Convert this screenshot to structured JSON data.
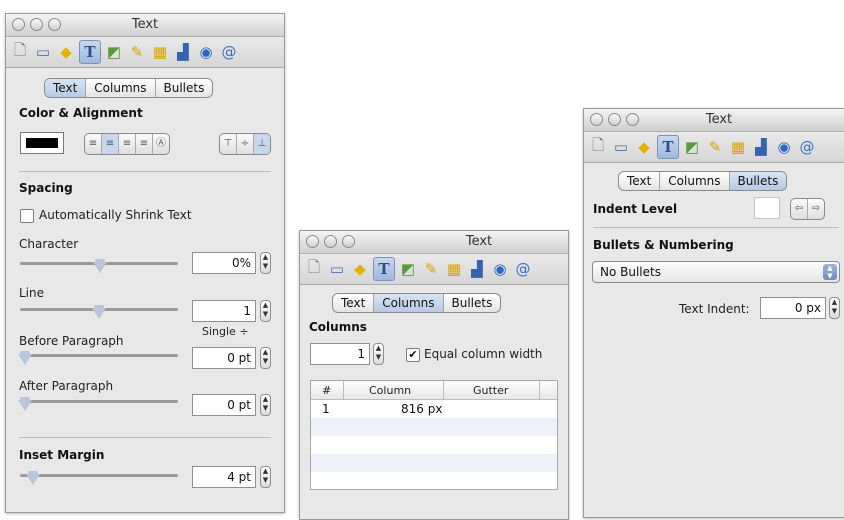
{
  "toolbar_icons": [
    "document-icon",
    "layout-icon",
    "wrap-icon",
    "text-icon",
    "graphic-icon",
    "metrics-icon",
    "table-icon",
    "chart-icon",
    "link-icon",
    "quicktime-icon"
  ],
  "panel1": {
    "title": "Text",
    "tabs": [
      "Text",
      "Columns",
      "Bullets"
    ],
    "color_alignment_heading": "Color & Alignment",
    "spacing_heading": "Spacing",
    "shrink_label": "Automatically Shrink Text",
    "character_label": "Character",
    "character_value": "0%",
    "line_label": "Line",
    "line_value": "1",
    "line_mode": "Single ÷",
    "before_label": "Before Paragraph",
    "before_value": "0 pt",
    "after_label": "After Paragraph",
    "after_value": "0 pt",
    "inset_heading": "Inset Margin",
    "inset_value": "4 pt"
  },
  "panel2": {
    "title": "Text",
    "tabs": [
      "Text",
      "Columns",
      "Bullets"
    ],
    "columns_heading": "Columns",
    "columns_value": "1",
    "equal_label": "Equal column width",
    "table_headers": [
      "#",
      "Column",
      "Gutter"
    ],
    "rows": [
      {
        "num": "1",
        "column": "816 px",
        "gutter": ""
      }
    ]
  },
  "panel3": {
    "title": "Text",
    "tabs": [
      "Text",
      "Columns",
      "Bullets"
    ],
    "indent_label": "Indent Level",
    "bullets_heading": "Bullets & Numbering",
    "bullets_value": "No Bullets",
    "text_indent_label": "Text Indent:",
    "text_indent_value": "0 px"
  }
}
